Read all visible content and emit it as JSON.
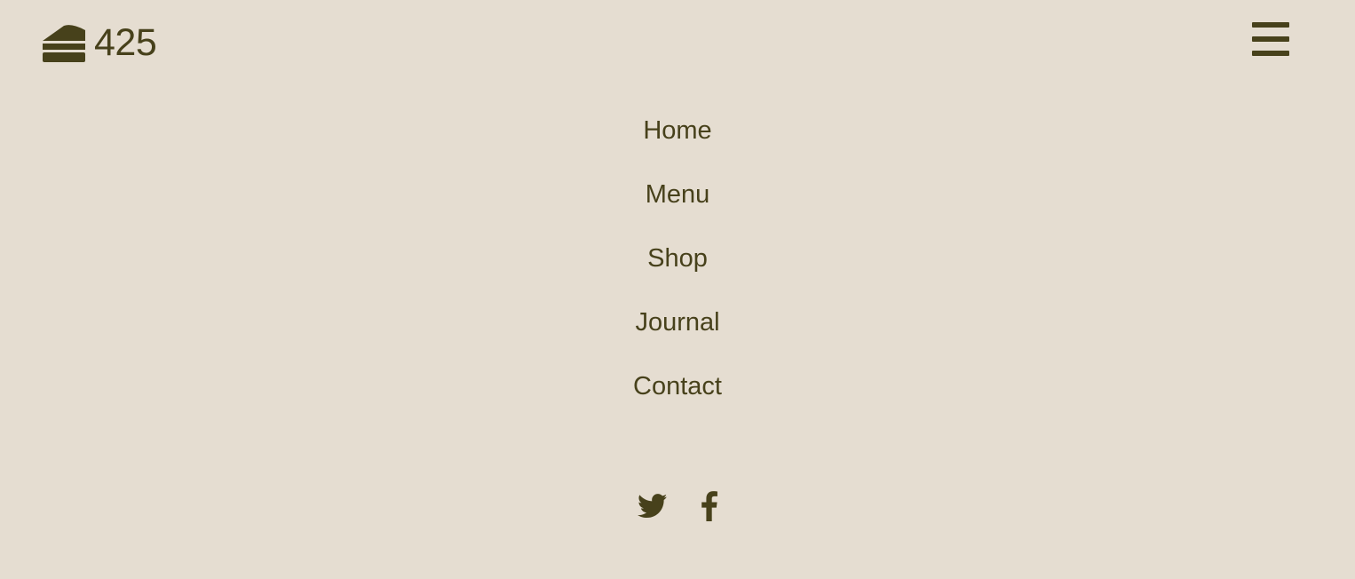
{
  "header": {
    "logo_text": "425",
    "logo_icon": "cake-slice-icon",
    "menu_icon": "hamburger-menu-icon"
  },
  "nav": {
    "items": [
      {
        "label": "Home"
      },
      {
        "label": "Menu"
      },
      {
        "label": "Shop"
      },
      {
        "label": "Journal"
      },
      {
        "label": "Contact"
      }
    ]
  },
  "social": {
    "icons": [
      "twitter-icon",
      "facebook-icon"
    ]
  },
  "colors": {
    "background": "#e5ddd1",
    "foreground": "#47411b"
  }
}
